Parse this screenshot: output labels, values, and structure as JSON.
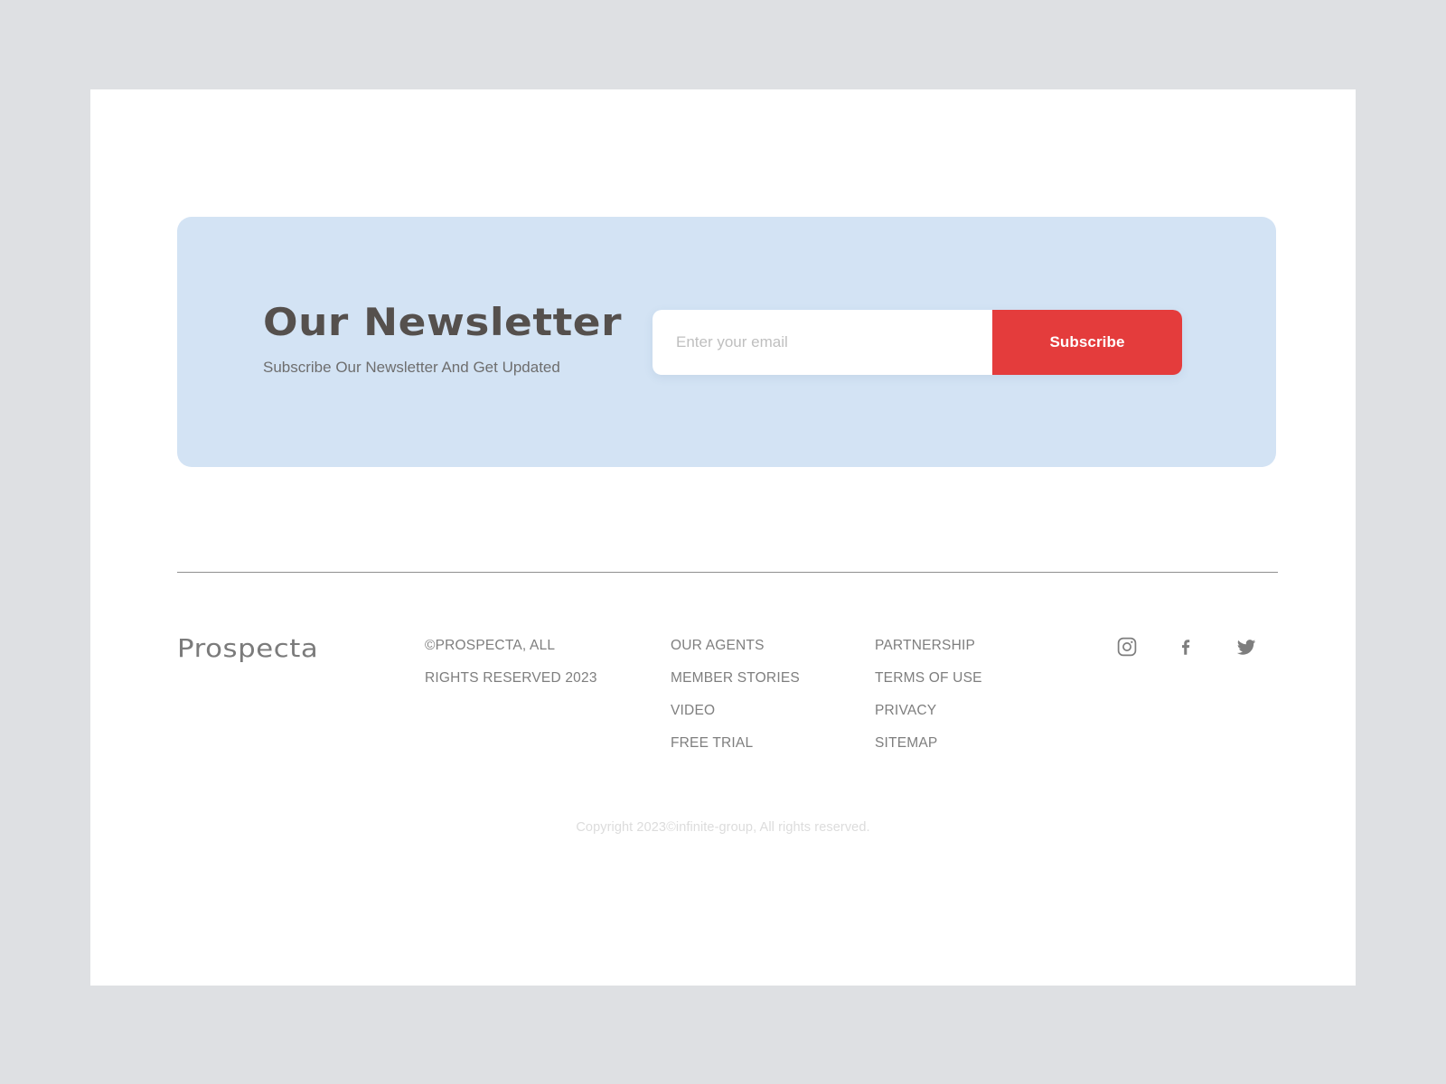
{
  "theme": {
    "page_background": "#ffffff",
    "outer_background": "#dee0e3",
    "newsletter_card_background": "#d3e3f4",
    "accent_red": "#e43c3c",
    "heading_color": "#55504d",
    "muted_text": "#7e7e7e",
    "copyright_color": "#dcdcdc"
  },
  "newsletter": {
    "title": "Our Newsletter",
    "subtitle": "Subscribe Our Newsletter And Get Updated",
    "email_placeholder": "Enter your email",
    "email_value": "",
    "subscribe_label": "Subscribe"
  },
  "footer": {
    "logo_text": "Prospecta",
    "legal": [
      "©PROSPECTA, ALL",
      "RIGHTS RESERVED 2023"
    ],
    "links_column_1": [
      "OUR AGENTS",
      "MEMBER STORIES",
      "VIDEO",
      "FREE TRIAL"
    ],
    "links_column_2": [
      "PARTNERSHIP",
      "TERMS OF USE",
      "PRIVACY",
      "SITEMAP"
    ],
    "social": [
      {
        "name": "instagram-icon",
        "label": "Instagram"
      },
      {
        "name": "facebook-icon",
        "label": "Facebook"
      },
      {
        "name": "twitter-icon",
        "label": "Twitter"
      }
    ],
    "copyright": "Copyright 2023©infinite-group, All rights reserved."
  }
}
